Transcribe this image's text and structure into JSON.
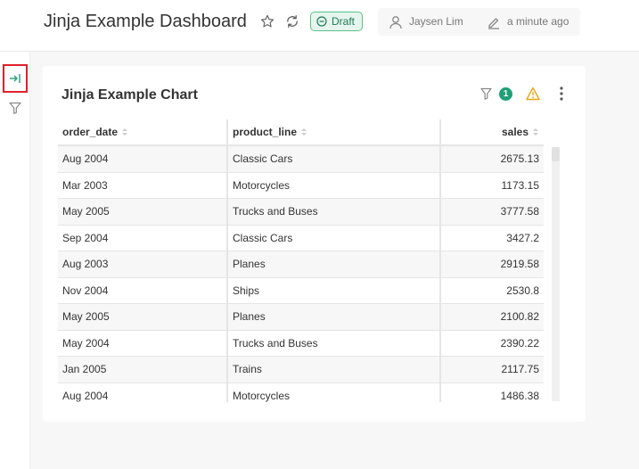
{
  "header": {
    "title": "Jinja Example Dashboard",
    "status_badge": "Draft",
    "author": "Jaysen Lim",
    "modified": "a minute ago"
  },
  "colors": {
    "accent_green": "#1fa077",
    "draft_border": "#5ac189",
    "warning": "#e0a818",
    "highlight_red": "#e0202a"
  },
  "icons": {
    "favorite": "star-icon",
    "refresh": "refresh-icon",
    "draft": "minus-circle-icon",
    "author": "user-icon",
    "modified": "pencil-icon",
    "expand": "expand-right-icon",
    "filter": "filter-icon",
    "warning": "warning-icon",
    "menu": "more-vertical-icon"
  },
  "chart": {
    "title": "Jinja Example Chart",
    "filter_count": "1"
  },
  "table": {
    "columns": [
      "order_date",
      "product_line",
      "sales"
    ],
    "rows": [
      [
        "Aug 2004",
        "Classic Cars",
        "2675.13"
      ],
      [
        "Mar 2003",
        "Motorcycles",
        "1173.15"
      ],
      [
        "May 2005",
        "Trucks and Buses",
        "3777.58"
      ],
      [
        "Sep 2004",
        "Classic Cars",
        "3427.2"
      ],
      [
        "Aug 2003",
        "Planes",
        "2919.58"
      ],
      [
        "Nov 2004",
        "Ships",
        "2530.8"
      ],
      [
        "May 2005",
        "Planes",
        "2100.82"
      ],
      [
        "May 2004",
        "Trucks and Buses",
        "2390.22"
      ],
      [
        "Jan 2005",
        "Trains",
        "2117.75"
      ],
      [
        "Aug 2004",
        "Motorcycles",
        "1486.38"
      ]
    ]
  }
}
